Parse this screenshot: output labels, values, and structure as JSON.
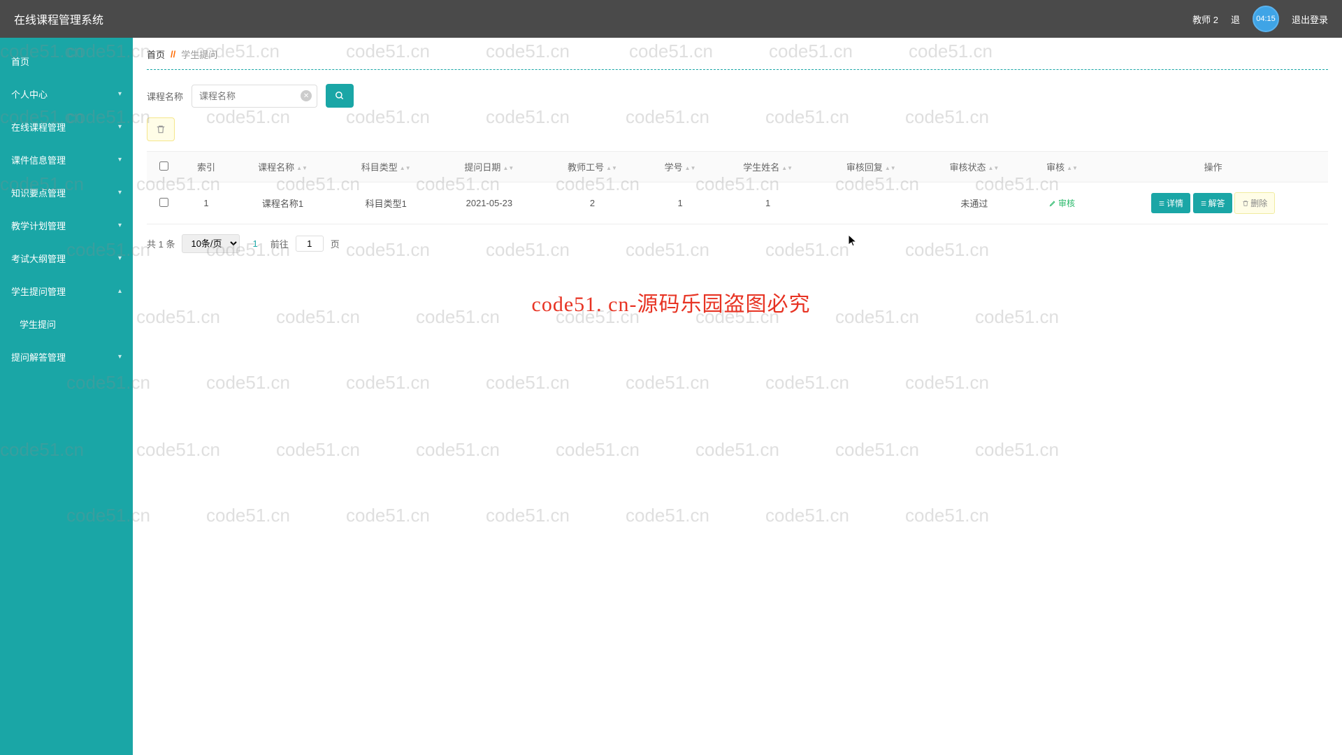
{
  "header": {
    "title": "在线课程管理系统",
    "user": "教师 2",
    "back_partial": "退",
    "avatar_text": "04:15",
    "logout": "退出登录"
  },
  "sidebar": {
    "items": [
      {
        "label": "首页",
        "has_children": false
      },
      {
        "label": "个人中心",
        "has_children": true
      },
      {
        "label": "在线课程管理",
        "has_children": true
      },
      {
        "label": "课件信息管理",
        "has_children": true
      },
      {
        "label": "知识要点管理",
        "has_children": true
      },
      {
        "label": "教学计划管理",
        "has_children": true
      },
      {
        "label": "考试大纲管理",
        "has_children": true
      },
      {
        "label": "学生提问管理",
        "has_children": true,
        "open": true
      },
      {
        "label": "学生提问",
        "sub": true
      },
      {
        "label": "提问解答管理",
        "has_children": true
      }
    ]
  },
  "breadcrumb": {
    "home": "首页",
    "sep": "//",
    "current": "学生提问"
  },
  "search": {
    "label": "课程名称",
    "placeholder": "课程名称"
  },
  "table": {
    "columns": [
      "索引",
      "课程名称",
      "科目类型",
      "提问日期",
      "教师工号",
      "学号",
      "学生姓名",
      "审核回复",
      "审核状态",
      "审核",
      "操作"
    ],
    "row": {
      "index": "1",
      "course": "课程名称1",
      "subject": "科目类型1",
      "date": "2021-05-23",
      "teacher_no": "2",
      "student_no": "1",
      "student_name": "1",
      "review_reply": "",
      "review_status": "未通过",
      "review_action": "审核",
      "detail": "详情",
      "answer": "解答",
      "delete": "删除"
    }
  },
  "pager": {
    "total": "共 1 条",
    "page_size": "10条/页",
    "current": "1",
    "goto_prefix": "前往",
    "goto_value": "1",
    "goto_suffix": "页"
  },
  "watermark": "code51.cn",
  "center_watermark": "code51. cn-源码乐园盗图必究"
}
